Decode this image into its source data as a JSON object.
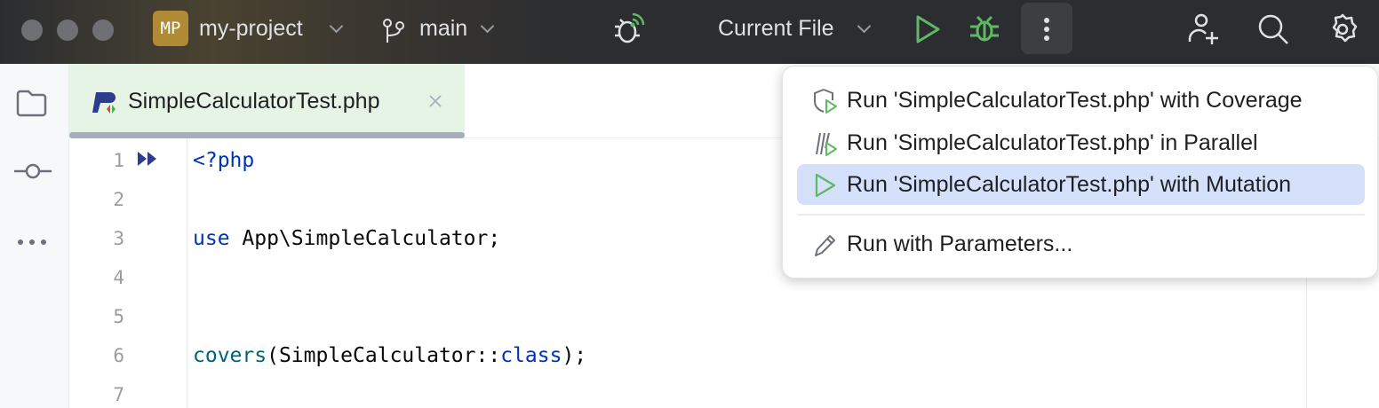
{
  "titlebar": {
    "project_initials": "MP",
    "project": "my-project",
    "branch": "main",
    "run_config": "Current File"
  },
  "tab": {
    "filename": "SimpleCalculatorTest.php"
  },
  "editor": {
    "line_numbers": [
      "1",
      "2",
      "3",
      "4",
      "5",
      "6",
      "7"
    ],
    "lines": {
      "l1": "<?php",
      "l3_kw": "use",
      "l3_rest": " App\\SimpleCalculator;",
      "l6_fn": "covers",
      "l6_mid": "(SimpleCalculator::",
      "l6_kw": "class",
      "l6_end": ");"
    }
  },
  "menu": {
    "items": [
      {
        "label": "Run 'SimpleCalculatorTest.php' with Coverage",
        "icon": "coverage-icon"
      },
      {
        "label": "Run 'SimpleCalculatorTest.php' in Parallel",
        "icon": "parallel-icon"
      },
      {
        "label": "Run 'SimpleCalculatorTest.php' with Mutation",
        "icon": "run-icon",
        "selected": true
      },
      {
        "label": "Run with Parameters...",
        "icon": "pencil-icon"
      }
    ]
  },
  "colors": {
    "run_green": "#5fb865",
    "selection": "#d5e0fb",
    "tab_bg": "#e5f4e5"
  }
}
